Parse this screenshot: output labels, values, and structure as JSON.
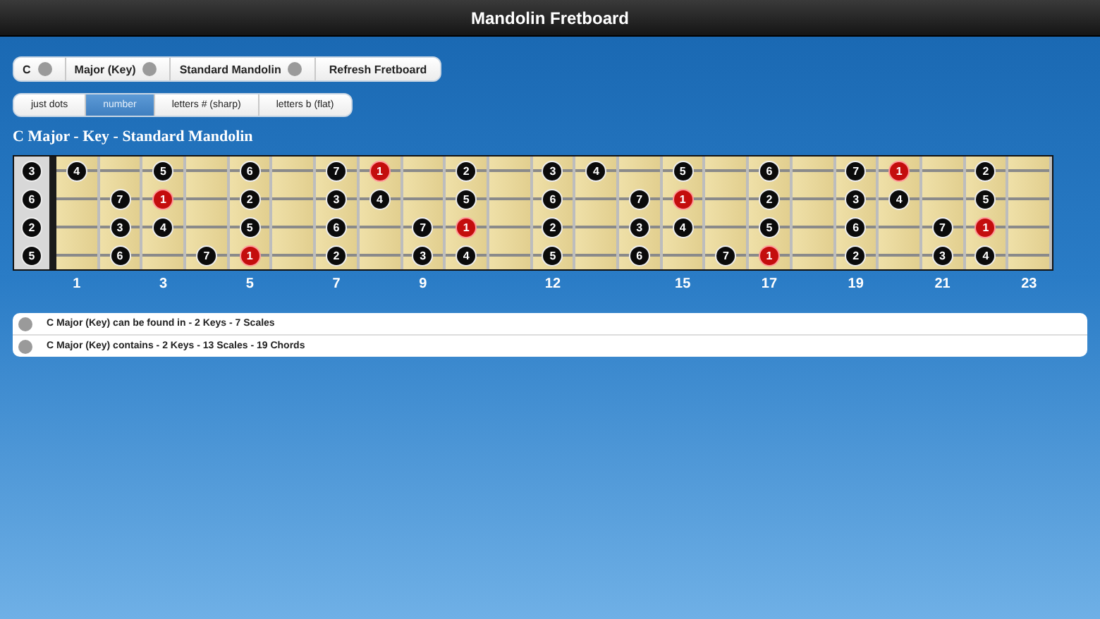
{
  "window": {
    "title": "Mandolin Fretboard"
  },
  "options": [
    {
      "label": "C",
      "kind": "dropdown"
    },
    {
      "label": "Major (Key)",
      "kind": "dropdown"
    },
    {
      "label": "Standard Mandolin",
      "kind": "dropdown"
    },
    {
      "label": "Refresh Fretboard",
      "kind": "button"
    }
  ],
  "display_tabs": [
    {
      "label": "just dots",
      "selected": false
    },
    {
      "label": "number",
      "selected": true
    },
    {
      "label": "letters # (sharp)",
      "selected": false
    },
    {
      "label": "letters b (flat)",
      "selected": false
    }
  ],
  "heading": "C Major - Key - Standard Mandolin",
  "fretboard": {
    "strings": [
      {
        "open": {
          "label": "3",
          "root": false
        },
        "frets": [
          {
            "kind": "note",
            "label": "4",
            "root": false
          },
          {
            "kind": "empty"
          },
          {
            "kind": "note",
            "label": "5",
            "root": false
          },
          {
            "kind": "empty"
          },
          {
            "kind": "note",
            "label": "6",
            "root": false
          },
          {
            "kind": "empty"
          },
          {
            "kind": "note",
            "label": "7",
            "root": false
          },
          {
            "kind": "note",
            "label": "1",
            "root": true
          },
          {
            "kind": "empty"
          },
          {
            "kind": "note",
            "label": "2",
            "root": false
          },
          {
            "kind": "empty"
          },
          {
            "kind": "note",
            "label": "3",
            "root": false
          },
          {
            "kind": "note",
            "label": "4",
            "root": false
          },
          {
            "kind": "empty"
          },
          {
            "kind": "note",
            "label": "5",
            "root": false
          },
          {
            "kind": "empty"
          },
          {
            "kind": "note",
            "label": "6",
            "root": false
          },
          {
            "kind": "empty"
          },
          {
            "kind": "note",
            "label": "7",
            "root": false
          },
          {
            "kind": "note",
            "label": "1",
            "root": true
          },
          {
            "kind": "empty"
          },
          {
            "kind": "note",
            "label": "2",
            "root": false
          },
          {
            "kind": "empty"
          }
        ]
      },
      {
        "open": {
          "label": "6",
          "root": false
        },
        "frets": [
          {
            "kind": "empty"
          },
          {
            "kind": "note",
            "label": "7",
            "root": false
          },
          {
            "kind": "note",
            "label": "1",
            "root": true
          },
          {
            "kind": "empty"
          },
          {
            "kind": "note",
            "label": "2",
            "root": false
          },
          {
            "kind": "empty"
          },
          {
            "kind": "note",
            "label": "3",
            "root": false
          },
          {
            "kind": "note",
            "label": "4",
            "root": false
          },
          {
            "kind": "empty"
          },
          {
            "kind": "note",
            "label": "5",
            "root": false
          },
          {
            "kind": "empty"
          },
          {
            "kind": "note",
            "label": "6",
            "root": false
          },
          {
            "kind": "empty"
          },
          {
            "kind": "note",
            "label": "7",
            "root": false
          },
          {
            "kind": "note",
            "label": "1",
            "root": true
          },
          {
            "kind": "empty"
          },
          {
            "kind": "note",
            "label": "2",
            "root": false
          },
          {
            "kind": "empty"
          },
          {
            "kind": "note",
            "label": "3",
            "root": false
          },
          {
            "kind": "note",
            "label": "4",
            "root": false
          },
          {
            "kind": "empty"
          },
          {
            "kind": "note",
            "label": "5",
            "root": false
          },
          {
            "kind": "empty"
          }
        ]
      },
      {
        "open": {
          "label": "2",
          "root": false
        },
        "frets": [
          {
            "kind": "empty"
          },
          {
            "kind": "note",
            "label": "3",
            "root": false
          },
          {
            "kind": "note",
            "label": "4",
            "root": false
          },
          {
            "kind": "empty"
          },
          {
            "kind": "note",
            "label": "5",
            "root": false
          },
          {
            "kind": "empty"
          },
          {
            "kind": "note",
            "label": "6",
            "root": false
          },
          {
            "kind": "empty"
          },
          {
            "kind": "note",
            "label": "7",
            "root": false
          },
          {
            "kind": "note",
            "label": "1",
            "root": true
          },
          {
            "kind": "empty"
          },
          {
            "kind": "note",
            "label": "2",
            "root": false
          },
          {
            "kind": "empty"
          },
          {
            "kind": "note",
            "label": "3",
            "root": false
          },
          {
            "kind": "note",
            "label": "4",
            "root": false
          },
          {
            "kind": "empty"
          },
          {
            "kind": "note",
            "label": "5",
            "root": false
          },
          {
            "kind": "empty"
          },
          {
            "kind": "note",
            "label": "6",
            "root": false
          },
          {
            "kind": "empty"
          },
          {
            "kind": "note",
            "label": "7",
            "root": false
          },
          {
            "kind": "note",
            "label": "1",
            "root": true
          },
          {
            "kind": "empty"
          }
        ]
      },
      {
        "open": {
          "label": "5",
          "root": false
        },
        "frets": [
          {
            "kind": "empty"
          },
          {
            "kind": "note",
            "label": "6",
            "root": false
          },
          {
            "kind": "empty"
          },
          {
            "kind": "note",
            "label": "7",
            "root": false
          },
          {
            "kind": "note",
            "label": "1",
            "root": true
          },
          {
            "kind": "empty"
          },
          {
            "kind": "note",
            "label": "2",
            "root": false
          },
          {
            "kind": "empty"
          },
          {
            "kind": "note",
            "label": "3",
            "root": false
          },
          {
            "kind": "note",
            "label": "4",
            "root": false
          },
          {
            "kind": "empty"
          },
          {
            "kind": "note",
            "label": "5",
            "root": false
          },
          {
            "kind": "empty"
          },
          {
            "kind": "note",
            "label": "6",
            "root": false
          },
          {
            "kind": "empty"
          },
          {
            "kind": "note",
            "label": "7",
            "root": false
          },
          {
            "kind": "note",
            "label": "1",
            "root": true
          },
          {
            "kind": "empty"
          },
          {
            "kind": "note",
            "label": "2",
            "root": false
          },
          {
            "kind": "empty"
          },
          {
            "kind": "note",
            "label": "3",
            "root": false
          },
          {
            "kind": "note",
            "label": "4",
            "root": false
          },
          {
            "kind": "empty"
          }
        ]
      }
    ],
    "fret_numbers": [
      {
        "kind": "number",
        "label": "1"
      },
      {
        "kind": "blank"
      },
      {
        "kind": "number",
        "label": "3"
      },
      {
        "kind": "blank"
      },
      {
        "kind": "number",
        "label": "5"
      },
      {
        "kind": "blank"
      },
      {
        "kind": "number",
        "label": "7"
      },
      {
        "kind": "blank"
      },
      {
        "kind": "number",
        "label": "9"
      },
      {
        "kind": "blank"
      },
      {
        "kind": "blank"
      },
      {
        "kind": "number",
        "label": "12"
      },
      {
        "kind": "blank"
      },
      {
        "kind": "blank"
      },
      {
        "kind": "number",
        "label": "15"
      },
      {
        "kind": "blank"
      },
      {
        "kind": "number",
        "label": "17"
      },
      {
        "kind": "blank"
      },
      {
        "kind": "number",
        "label": "19"
      },
      {
        "kind": "blank"
      },
      {
        "kind": "number",
        "label": "21"
      },
      {
        "kind": "blank"
      },
      {
        "kind": "number",
        "label": "23"
      }
    ]
  },
  "info": [
    "C Major (Key) can be found in - 2 Keys - 7 Scales",
    "C Major (Key) contains - 2 Keys - 13 Scales - 19 Chords"
  ]
}
